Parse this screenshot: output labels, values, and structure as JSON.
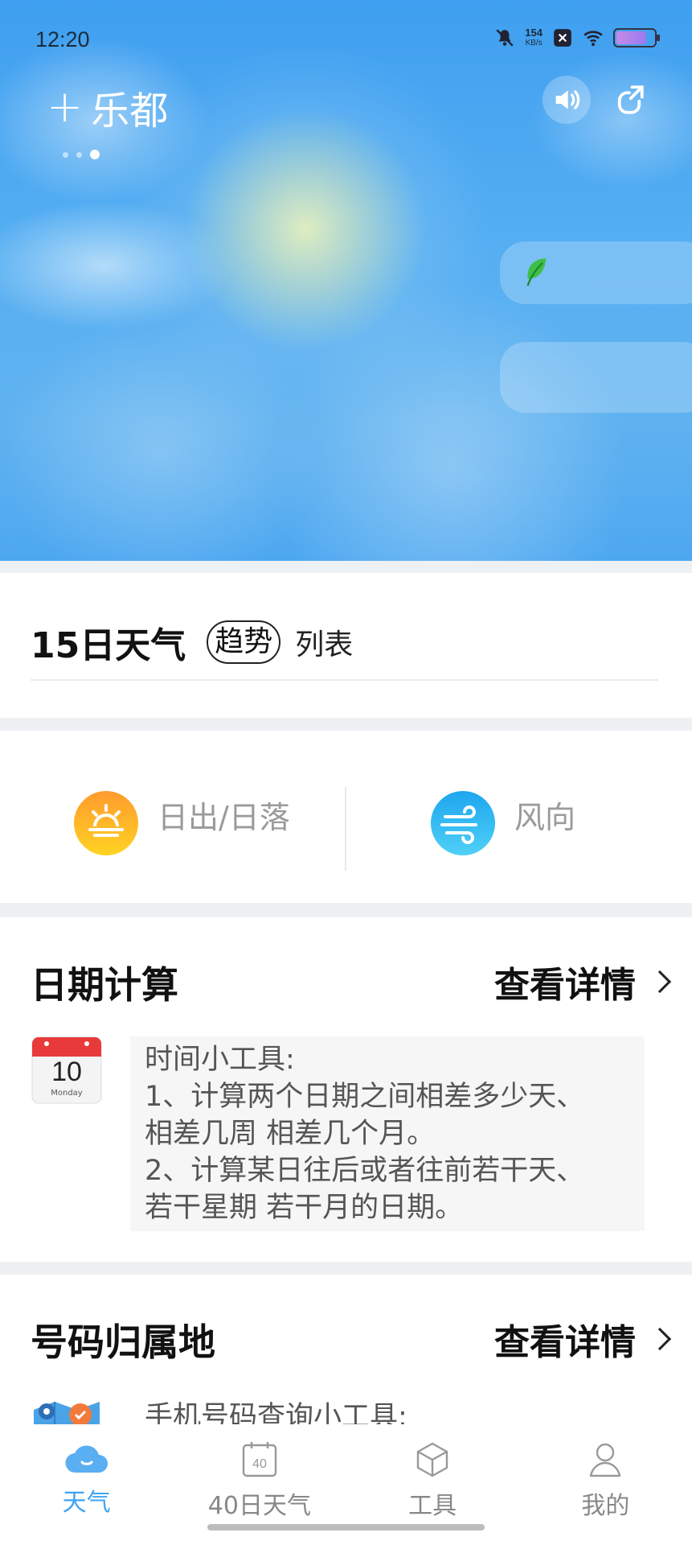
{
  "status_bar": {
    "time": "12:20",
    "net_speed_value": "154",
    "net_speed_unit": "KB/s"
  },
  "header": {
    "city": "乐都",
    "add_symbol": "+"
  },
  "forecast": {
    "title": "15日天气",
    "tab_trend": "趋势",
    "tab_list": "列表"
  },
  "sun_wind": {
    "sun_label": "日出/日落",
    "wind_label": "风向"
  },
  "date_calc": {
    "title": "日期计算",
    "more": "查看详情",
    "calendar_day": "10",
    "calendar_weekday": "Monday",
    "lines": [
      "时间小工具:",
      "1、计算两个日期之间相差多少天、",
      "相差几周 相差几个月。",
      "2、计算某日往后或者往前若干天、",
      "若干星期 若干月的日期。"
    ]
  },
  "phone_lookup": {
    "title": "号码归属地",
    "more": "查看详情",
    "desc": "手机号码查询小工具:"
  },
  "bottom_nav": [
    {
      "label": "天气",
      "icon": "cloud-icon",
      "active": true
    },
    {
      "label": "40日天气",
      "icon": "calendar-40-icon",
      "badge": "40",
      "active": false
    },
    {
      "label": "工具",
      "icon": "box-icon",
      "active": false
    },
    {
      "label": "我的",
      "icon": "person-icon",
      "active": false
    }
  ],
  "colors": {
    "accent": "#3fa4f2",
    "sky": "#4ea8f0"
  }
}
